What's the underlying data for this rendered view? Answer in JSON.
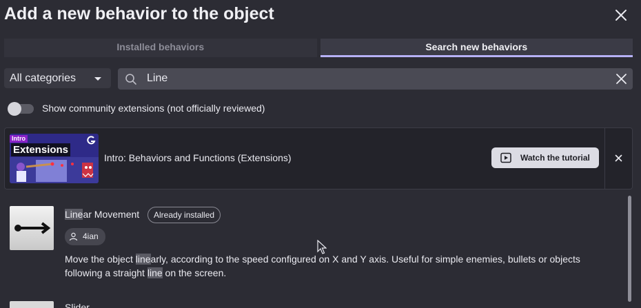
{
  "dialog": {
    "title": "Add a new behavior to the object"
  },
  "tabs": [
    {
      "label": "Installed behaviors"
    },
    {
      "label": "Search new behaviors"
    }
  ],
  "filters": {
    "category": "All categories",
    "search_value": "Line",
    "community_toggle_label": "Show community extensions (not officially reviewed)"
  },
  "tutorial": {
    "badge": "Intro",
    "thumb_title": "Extensions",
    "label": "Intro: Behaviors and Functions (Extensions)",
    "button": "Watch the tutorial"
  },
  "results": [
    {
      "name_match": "Line",
      "name_rest": "ar Movement",
      "chip": "Already installed",
      "author": "4ian",
      "desc": [
        {
          "t": "Move the object ",
          "hl": false
        },
        {
          "t": "line",
          "hl": true
        },
        {
          "t": "arly, according to the speed configured on X and Y axis. Useful for simple enemies, bullets or objects following a straight ",
          "hl": false
        },
        {
          "t": "line",
          "hl": true
        },
        {
          "t": " on the screen.",
          "hl": false
        }
      ]
    },
    {
      "name": "Slider"
    }
  ],
  "colors": {
    "accent": "#b7b2f8",
    "background": "#2c2c34",
    "card": "#23232a"
  },
  "icons": [
    "close-icon",
    "search-icon",
    "clear-search-icon",
    "play-icon",
    "user-icon",
    "caret-down-icon",
    "arrow-right-icon",
    "gdevelop-logo-icon"
  ]
}
